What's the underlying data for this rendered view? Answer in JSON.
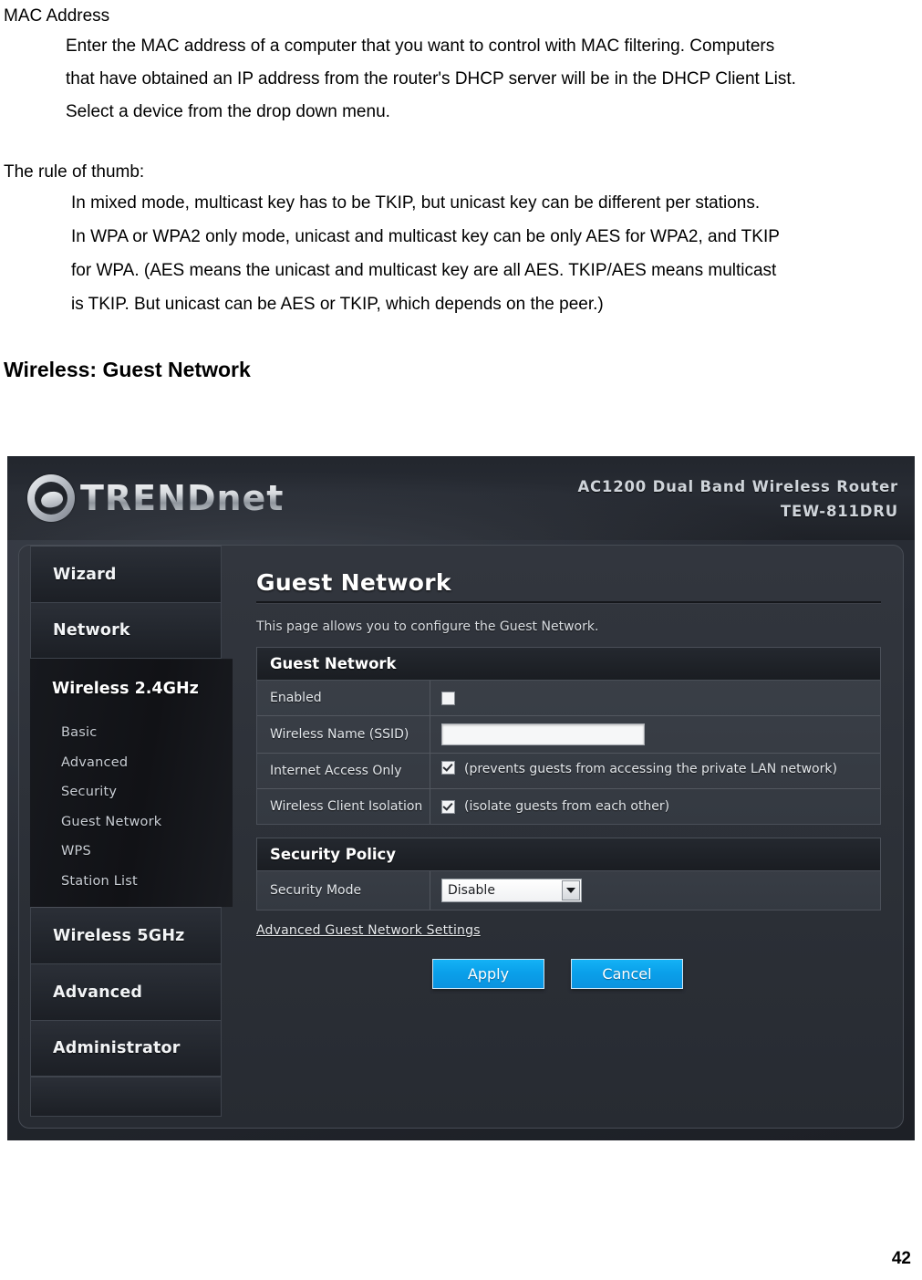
{
  "document": {
    "mac_heading": "MAC Address",
    "mac_paragraph": [
      "Enter the MAC address of a computer that you want to control with MAC filtering. Computers",
      "that have obtained an IP address from the router's DHCP server will be in the DHCP Client List.",
      "Select a device from the drop down menu."
    ],
    "rule_heading": "The rule of thumb:",
    "rule_paragraph": [
      "In mixed mode, multicast key has to be TKIP, but unicast key can be different per stations.",
      "In WPA or WPA2 only mode, unicast and multicast key can be only AES for WPA2, and TKIP",
      "for WPA. (AES means the unicast and multicast key are all AES. TKIP/AES means multicast",
      "is TKIP. But unicast can be AES or TKIP, which depends on the peer.)"
    ],
    "section_title": "Wireless: Guest Network",
    "page_number": "42"
  },
  "router_ui": {
    "brand": "TRENDnet",
    "model_line1": "AC1200 Dual Band Wireless Router",
    "model_line2": "TEW-811DRU",
    "sidebar": {
      "top_items": [
        {
          "label": "Wizard"
        },
        {
          "label": "Network"
        }
      ],
      "active_group": {
        "label": "Wireless 2.4GHz",
        "sub_items": [
          {
            "label": "Basic"
          },
          {
            "label": "Advanced"
          },
          {
            "label": "Security"
          },
          {
            "label": "Guest Network"
          },
          {
            "label": "WPS"
          },
          {
            "label": "Station List"
          }
        ]
      },
      "bottom_items": [
        {
          "label": "Wireless 5GHz"
        },
        {
          "label": "Advanced"
        },
        {
          "label": "Administrator"
        }
      ]
    },
    "main": {
      "title": "Guest Network",
      "description": "This page allows you to configure the Guest Network.",
      "guest_panel": {
        "heading": "Guest Network",
        "rows": [
          {
            "label": "Enabled",
            "type": "checkbox",
            "checked": false,
            "hint": ""
          },
          {
            "label": "Wireless Name (SSID)",
            "type": "text",
            "value": "",
            "placeholder": ""
          },
          {
            "label": "Internet Access Only",
            "type": "checkbox",
            "checked": true,
            "hint": "(prevents guests from accessing the private LAN network)"
          },
          {
            "label": "Wireless Client Isolation",
            "type": "checkbox",
            "checked": true,
            "hint": "(isolate guests from each other)"
          }
        ]
      },
      "security_panel": {
        "heading": "Security Policy",
        "security_mode_label": "Security Mode",
        "security_mode_value": "Disable",
        "security_mode_options": [
          "Disable"
        ]
      },
      "advanced_link": "Advanced Guest Network Settings",
      "apply_label": "Apply",
      "cancel_label": "Cancel"
    },
    "colors": {
      "button_blue": "#0aa0ea",
      "panel_dark": "#1a1d22",
      "frame_bg": "#2d313a"
    }
  }
}
